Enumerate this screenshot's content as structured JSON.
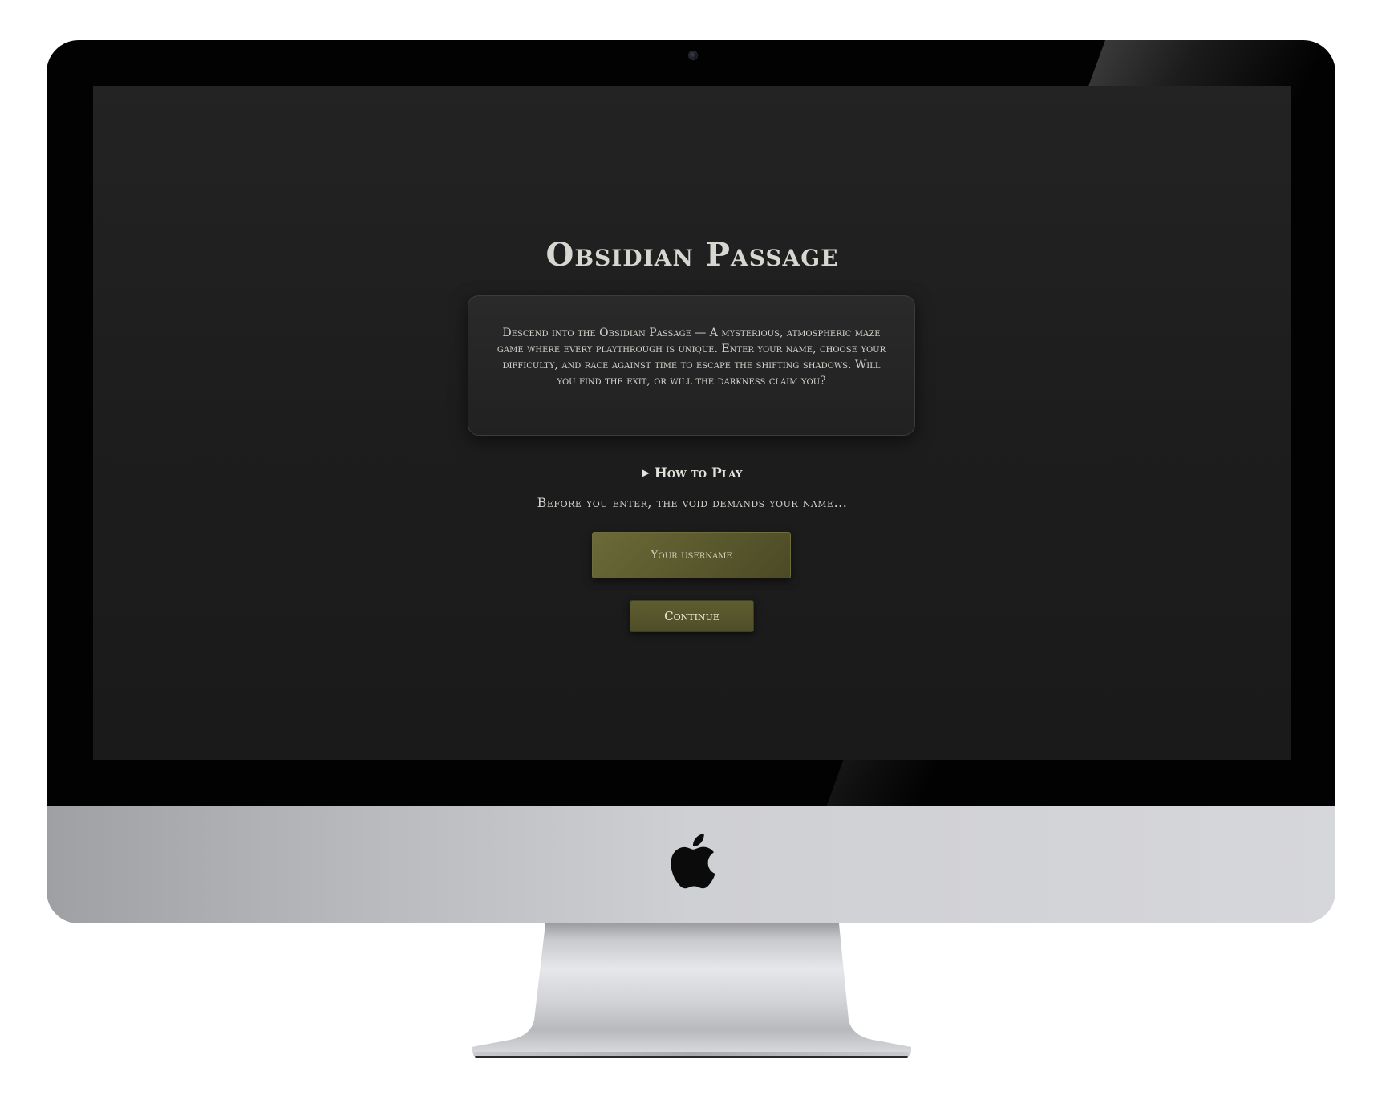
{
  "device": {
    "type": "iMac",
    "logo_icon": "apple-logo-icon"
  },
  "game": {
    "title": "Obsidian Passage",
    "intro": "Descend into the Obsidian Passage — A mysterious, atmospheric maze game where every playthrough is unique. Enter your name, choose your difficulty, and race against time to escape the shifting shadows. Will you find the exit, or will the darkness claim you?",
    "how_to_play": {
      "icon": "disclosure-triangle-icon",
      "label": "How to Play",
      "expanded": false
    },
    "prompt": "Before you enter, the void demands your name...",
    "username": {
      "value": "",
      "placeholder": "Your username"
    },
    "continue_label": "Continue"
  },
  "colors": {
    "screen_background": "#1d1d1d",
    "accent_olive": "#5b5a2e",
    "text_light": "#d8d6d0"
  }
}
